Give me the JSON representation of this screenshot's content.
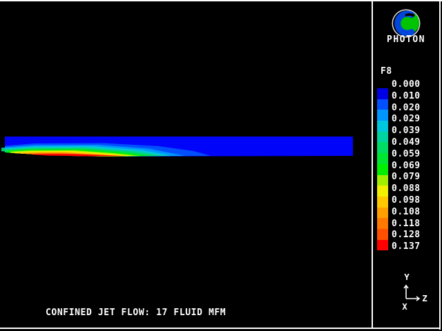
{
  "app": {
    "name": "PHOTON"
  },
  "sidebar": {
    "logo": {
      "label": "PHOTON"
    },
    "legend": {
      "field": "F8",
      "entries": [
        {
          "value": "0.000",
          "color": "#0000E6"
        },
        {
          "value": "0.010",
          "color": "#0050FF"
        },
        {
          "value": "0.020",
          "color": "#0096FF"
        },
        {
          "value": "0.029",
          "color": "#00C8DC"
        },
        {
          "value": "0.039",
          "color": "#00D2A0"
        },
        {
          "value": "0.049",
          "color": "#00DC64"
        },
        {
          "value": "0.059",
          "color": "#00E632"
        },
        {
          "value": "0.069",
          "color": "#00F000"
        },
        {
          "value": "0.079",
          "color": "#A0F000"
        },
        {
          "value": "0.088",
          "color": "#F0F000"
        },
        {
          "value": "0.098",
          "color": "#FFC800"
        },
        {
          "value": "0.108",
          "color": "#FFA000"
        },
        {
          "value": "0.118",
          "color": "#FF7800"
        },
        {
          "value": "0.128",
          "color": "#FF5000"
        },
        {
          "value": "0.137",
          "color": "#FF0000"
        }
      ]
    },
    "axis_triad": {
      "up_label": "Y",
      "right_label": "Z",
      "out_label": "X"
    }
  },
  "plot": {
    "caption": "CONFINED JET FLOW: 17 FLUID MFM"
  },
  "chart_data": {
    "type": "heatmap",
    "title": "CONFINED JET FLOW: 17 FLUID MFM",
    "field": "F8",
    "contour_levels": [
      0.0,
      0.01,
      0.02,
      0.029,
      0.039,
      0.049,
      0.059,
      0.069,
      0.079,
      0.088,
      0.098,
      0.108,
      0.118,
      0.128,
      0.137
    ],
    "level_colors": [
      "#0000E6",
      "#0050FF",
      "#0096FF",
      "#00C8DC",
      "#00D2A0",
      "#00DC64",
      "#00E632",
      "#00F000",
      "#A0F000",
      "#F0F000",
      "#FFC800",
      "#FFA000",
      "#FF7800",
      "#FF5000",
      "#FF0000"
    ],
    "value_range": [
      0.0,
      0.137
    ],
    "legend_position": "right",
    "description": "Horizontal duct shown in Y-Z plane; jet enters at left with peak concentration (red ~0.137) near lower-left wall, plume decays downstream into uniform low-value blue field"
  }
}
